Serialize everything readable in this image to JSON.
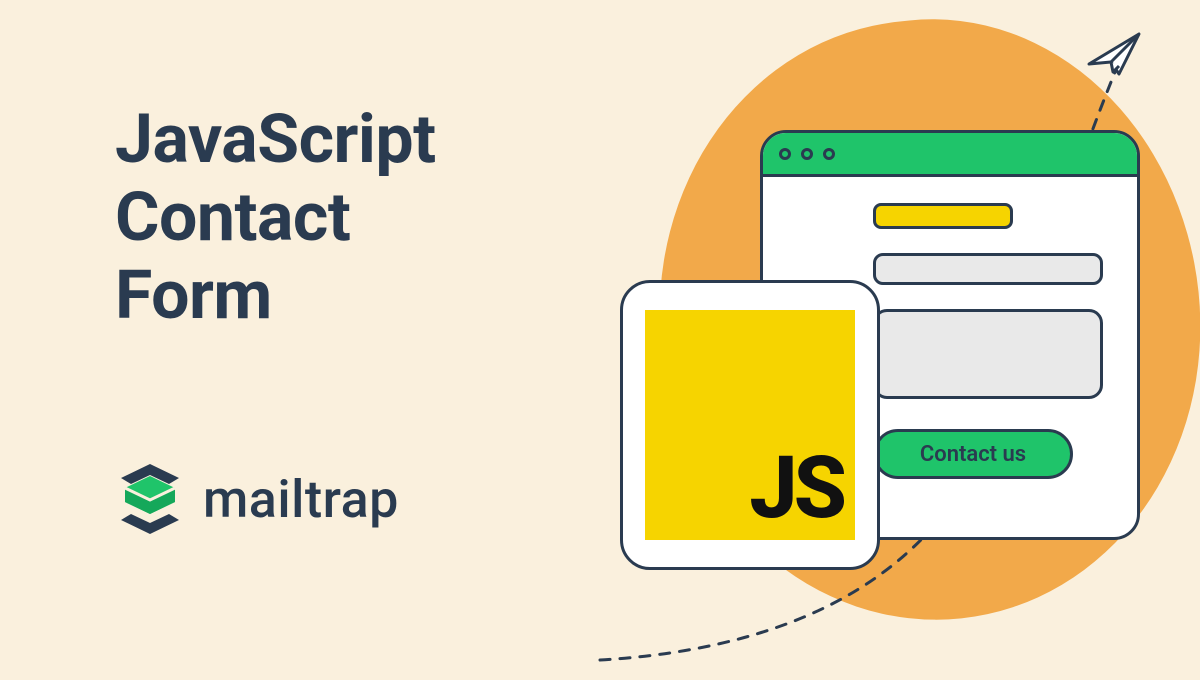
{
  "headline": {
    "line1": "JavaScript",
    "line2": "Contact",
    "line3": "Form"
  },
  "brand": {
    "name": "mailtrap"
  },
  "js_badge": {
    "label": "JS"
  },
  "contact_button": {
    "label": "Contact us"
  }
}
